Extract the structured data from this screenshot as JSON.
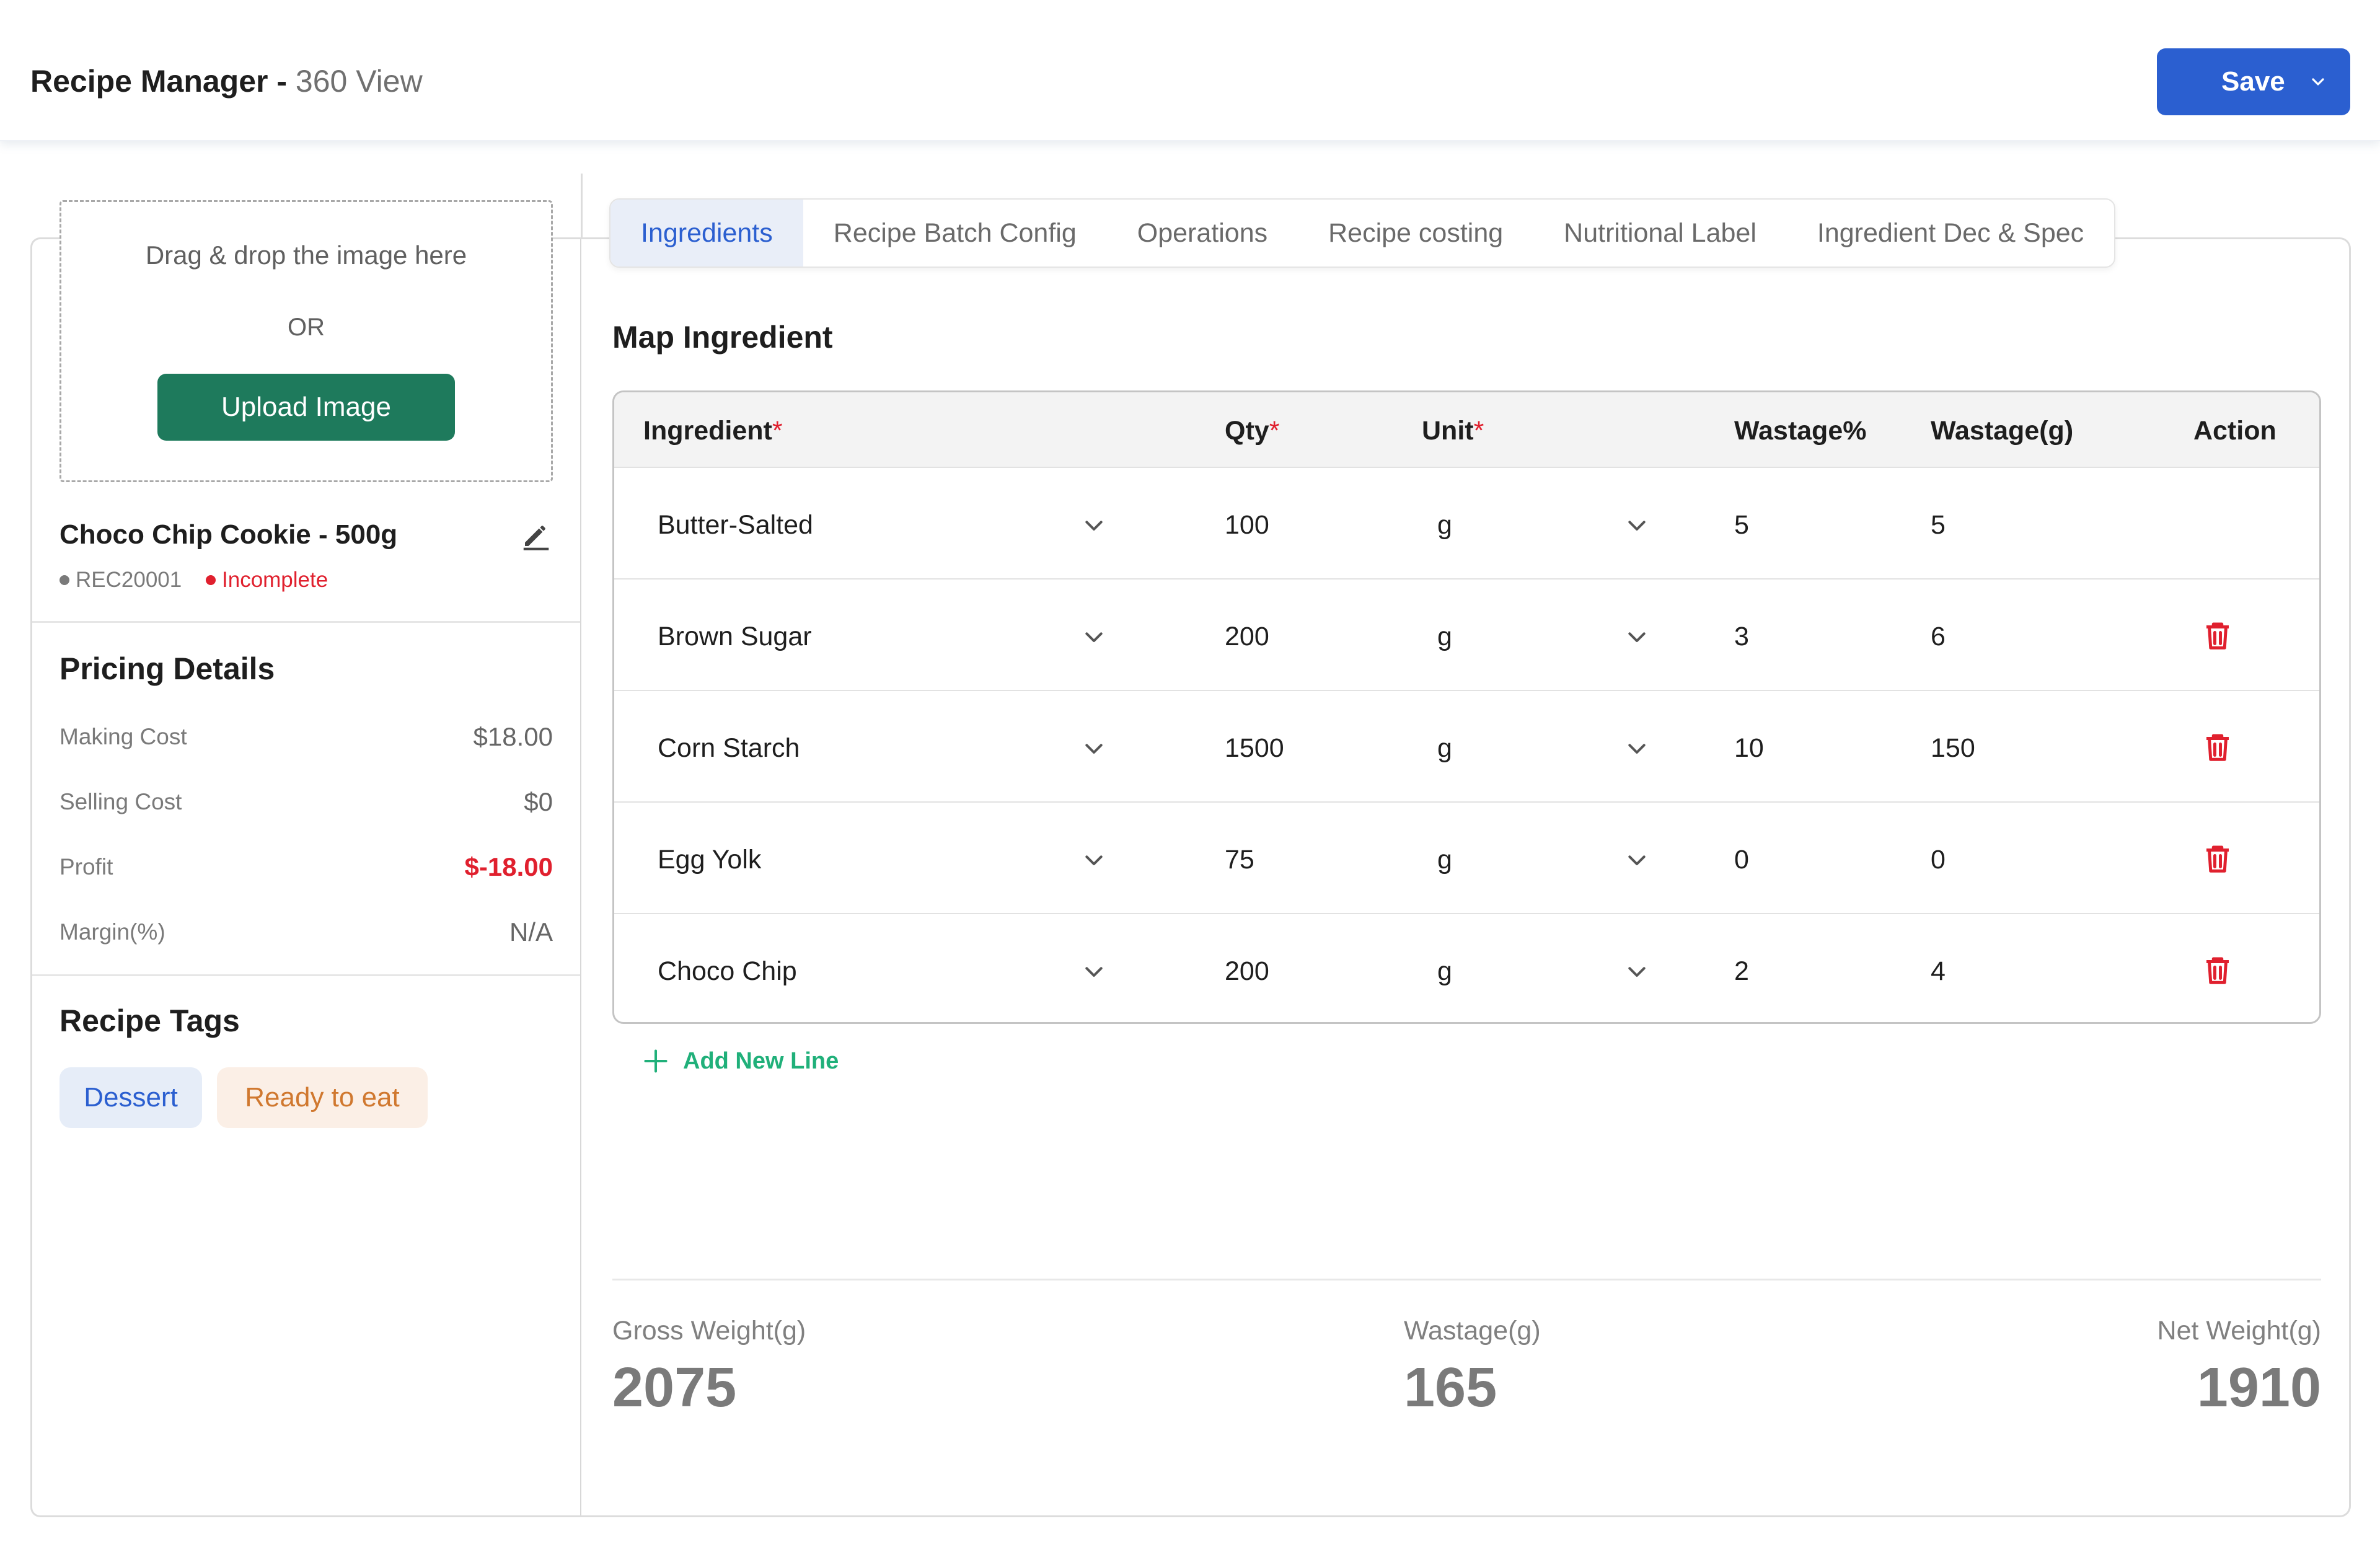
{
  "header": {
    "title": "Recipe Manager - ",
    "subtitle": "360 View",
    "save_label": "Save",
    "accent": "#2b5fd0"
  },
  "upload": {
    "drag_text": "Drag & drop the image here",
    "or_text": "OR",
    "button_label": "Upload Image"
  },
  "recipe": {
    "name": "Choco Chip Cookie - 500g",
    "code": "REC20001",
    "status": "Incomplete",
    "status_color": "#e0202e"
  },
  "pricing": {
    "title": "Pricing Details",
    "rows": [
      {
        "label": "Making Cost",
        "value": "$18.00"
      },
      {
        "label": "Selling Cost",
        "value": "$0"
      },
      {
        "label": "Profit",
        "value": "$-18.00"
      },
      {
        "label": "Margin(%)",
        "value": "N/A"
      }
    ]
  },
  "tags": {
    "title": "Recipe Tags",
    "items": [
      "Dessert",
      "Ready to eat"
    ]
  },
  "tabs": [
    "Ingredients",
    "Recipe Batch Config",
    "Operations",
    "Recipe costing",
    "Nutritional Label",
    "Ingredient Dec & Spec"
  ],
  "active_tab": "Ingredients",
  "map": {
    "title": "Map Ingredient",
    "columns": {
      "ingredient": "Ingredient",
      "qty": "Qty",
      "unit": "Unit",
      "wastage_pct": "Wastage%",
      "wastage_g": "Wastage(g)",
      "action": "Action",
      "required_mark": "*"
    },
    "rows": [
      {
        "ingredient": "Butter-Salted",
        "qty": "100",
        "unit": "g",
        "wastage_pct": "5",
        "wastage_g": "5"
      },
      {
        "ingredient": "Brown Sugar",
        "qty": "200",
        "unit": "g",
        "wastage_pct": "3",
        "wastage_g": "6"
      },
      {
        "ingredient": "Corn Starch",
        "qty": "1500",
        "unit": "g",
        "wastage_pct": "10",
        "wastage_g": "150"
      },
      {
        "ingredient": "Egg Yolk",
        "qty": "75",
        "unit": "g",
        "wastage_pct": "0",
        "wastage_g": "0"
      },
      {
        "ingredient": "Choco Chip",
        "qty": "200",
        "unit": "g",
        "wastage_pct": "2",
        "wastage_g": "4"
      }
    ],
    "add_line_label": "Add New Line"
  },
  "summary": {
    "gross_label": "Gross Weight(g)",
    "gross_value": "2075",
    "wastage_label": "Wastage(g)",
    "wastage_value": "165",
    "net_label": "Net Weight(g)",
    "net_value": "1910"
  }
}
